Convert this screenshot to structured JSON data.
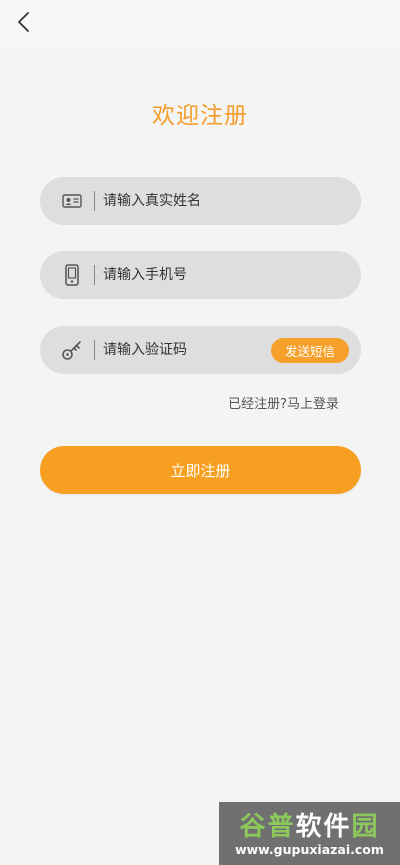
{
  "header": {
    "back_icon": "chevron-left-icon"
  },
  "title": "欢迎注册",
  "form": {
    "name_placeholder": "请输入真实姓名",
    "phone_placeholder": "请输入手机号",
    "code_placeholder": "请输入验证码",
    "send_sms_label": "发送短信",
    "login_link": "已经注册?马上登录",
    "register_label": "立即注册"
  },
  "icons": {
    "name": "id-card-icon",
    "phone": "mobile-phone-icon",
    "code": "key-icon"
  },
  "colors": {
    "accent": "#f79f21",
    "title": "#f59d2a",
    "field_bg": "#dedede",
    "page_bg": "#f4f4f4"
  },
  "watermark": {
    "brand_part1": "谷普",
    "brand_part2": "软件",
    "brand_part3": "园",
    "url": "www.gupuxiazai.com"
  }
}
